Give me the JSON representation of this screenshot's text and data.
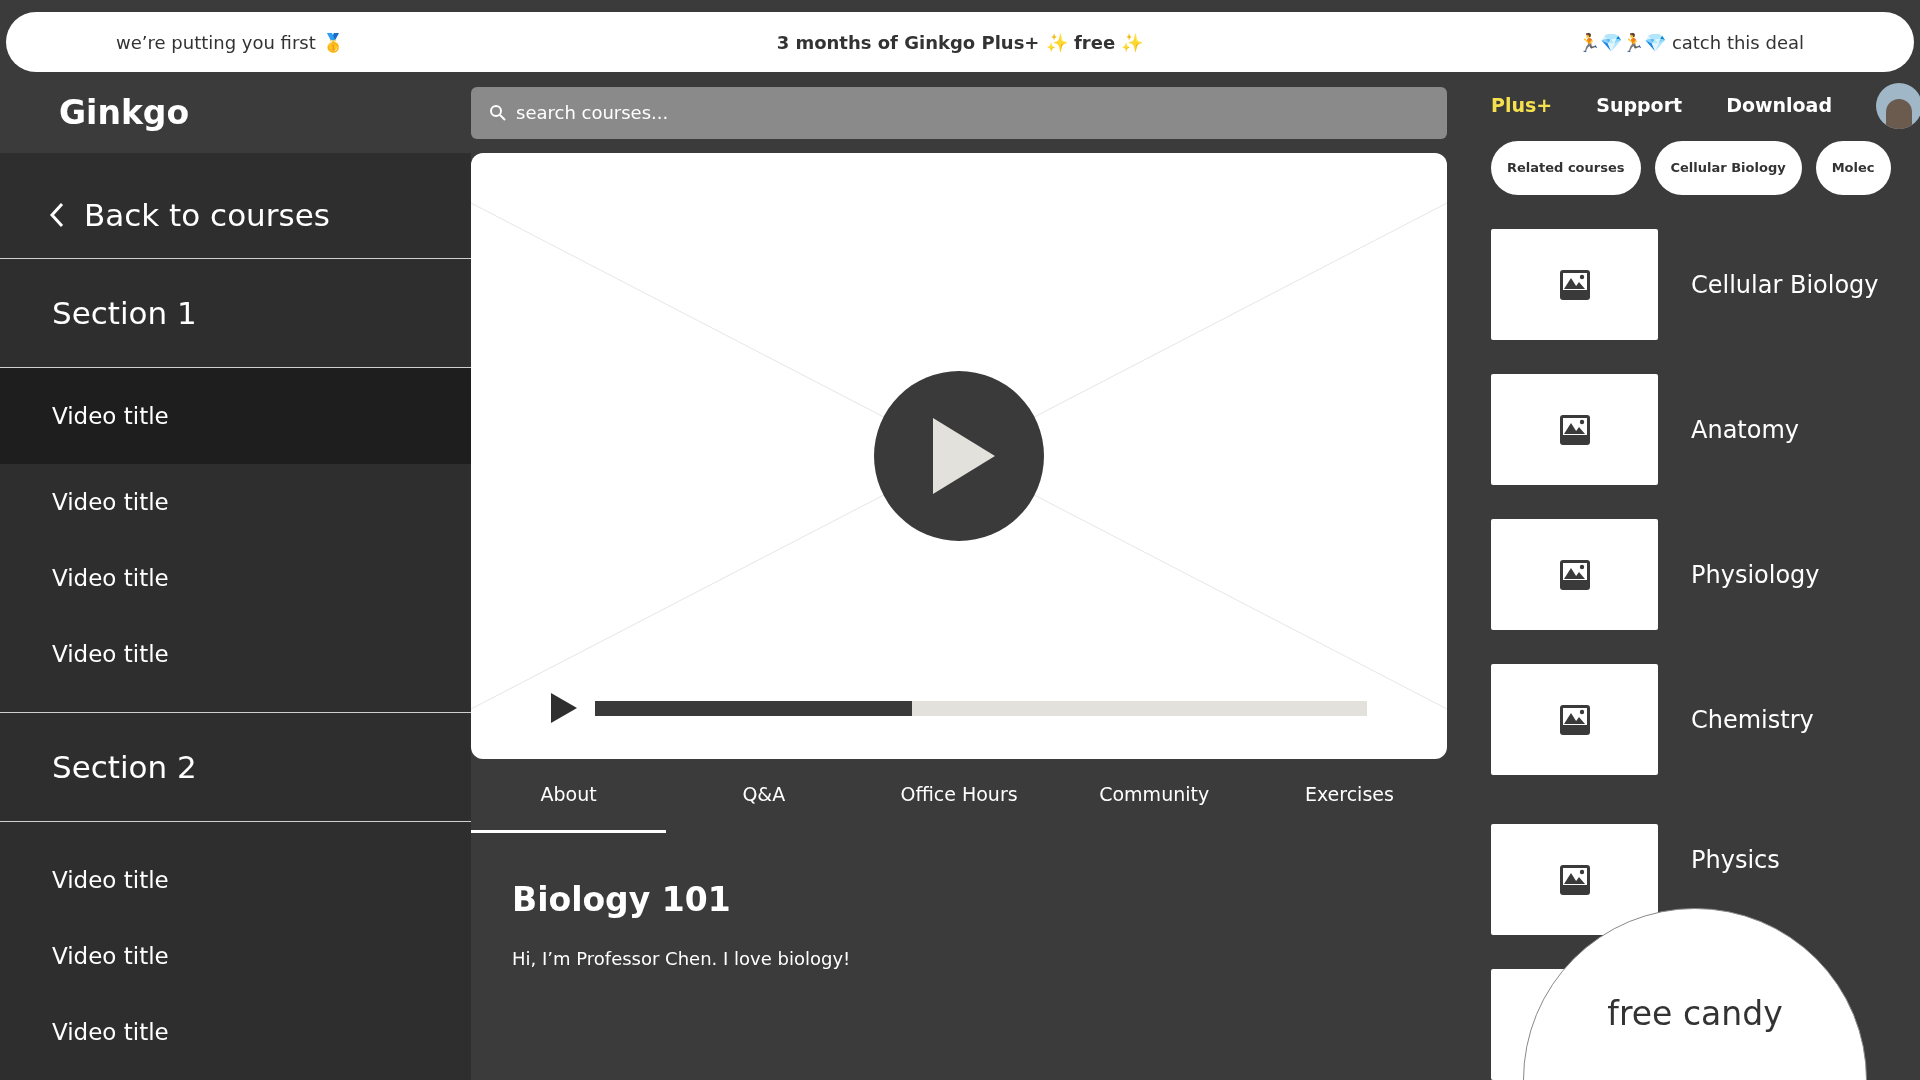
{
  "banner": {
    "left": "we’re putting you first 🥇",
    "center": "3 months of Ginkgo Plus+ ✨ free ✨",
    "right": "🏃💎🏃💎 catch this deal"
  },
  "header": {
    "logo": "Ginkgo",
    "search": {
      "placeholder": "search courses..."
    },
    "nav": [
      {
        "label": "Plus+",
        "kind": "highlight"
      },
      {
        "label": "Support",
        "kind": "plain"
      },
      {
        "label": "Download",
        "kind": "plain"
      }
    ]
  },
  "sidebar": {
    "back": "Back to courses",
    "sections": [
      {
        "title": "Section 1",
        "videos": [
          {
            "title": "Video title",
            "selected": true
          },
          {
            "title": "Video title",
            "selected": false
          },
          {
            "title": "Video title",
            "selected": false
          },
          {
            "title": "Video title",
            "selected": false
          }
        ]
      },
      {
        "title": "Section 2",
        "videos": [
          {
            "title": "Video title",
            "selected": false
          },
          {
            "title": "Video title",
            "selected": false
          },
          {
            "title": "Video title",
            "selected": false
          }
        ]
      }
    ]
  },
  "player": {
    "level": 0.41
  },
  "tabs": [
    {
      "label": "About",
      "selected": true
    },
    {
      "label": "Q&A",
      "selected": false
    },
    {
      "label": "Office Hours",
      "selected": false
    },
    {
      "label": "Community",
      "selected": false
    },
    {
      "label": "Exercises",
      "selected": false
    }
  ],
  "about": {
    "title": "Biology 101",
    "text": "Hi, I’m Professor Chen. I love biology!"
  },
  "chips": [
    "Related courses",
    "Cellular Biology",
    "Molec"
  ],
  "courses": [
    {
      "name": "Cellular Biology"
    },
    {
      "name": "Anatomy"
    },
    {
      "name": "Physiology"
    },
    {
      "name": "Chemistry"
    },
    {
      "name": "Physics"
    }
  ],
  "popup": {
    "text": "free candy"
  }
}
